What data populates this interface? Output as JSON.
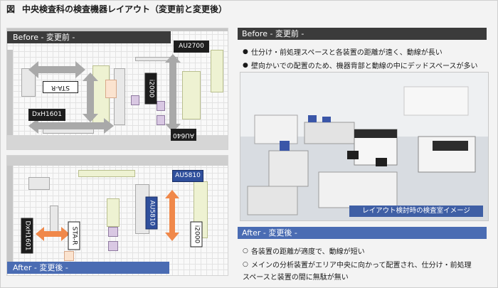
{
  "figure": {
    "number": "図",
    "title": "中央検査科の検査機器レイアウト（変更前と変更後）"
  },
  "before_plan": {
    "label": "Before - 変更前 -",
    "tags": {
      "au2700": "AU2700",
      "star": "STA-R",
      "dxh": "DxH1601",
      "i2000": "i2000",
      "au640": "AU640"
    }
  },
  "after_plan": {
    "label": "After - 変更後 -",
    "tags": {
      "au5810_top": "AU5810",
      "dxh": "DxH1601",
      "star": "STA-R",
      "au5810_mid": "AU5810",
      "i2000": "i2000"
    }
  },
  "before_section": {
    "heading": "Before - 変更前 -",
    "bullets": [
      "仕分け・前処理スペースと各装置の距離が遠く、動線が長い",
      "壁向かいでの配置のため、機器背部と動線の中にデッドスペースが多い"
    ],
    "bullet_marker": "●"
  },
  "photo": {
    "caption": "レイアウト検討時の検査室イメージ"
  },
  "after_section": {
    "heading": "After - 変更後 -",
    "bullets": [
      "各装置の距離が適度で、動線が短い",
      "メインの分析装置がエリア中央に向かって配置され、仕分け・前処理"
    ],
    "continuation": "スペースと装置の間に無駄が無い",
    "bullet_marker": "○"
  },
  "colors": {
    "before_accent": "#3b3b3b",
    "after_accent": "#4a6cb3",
    "arrow_gray": "#a9a9a9",
    "arrow_orange": "#f0884a"
  }
}
